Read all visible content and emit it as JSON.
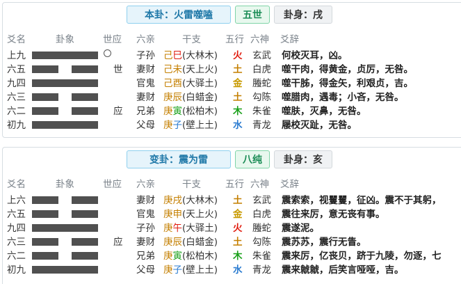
{
  "ben": {
    "title": "本卦：火雷噬嗑",
    "shi": "五世",
    "body": "卦身：戌",
    "headers": {
      "yao": "爻名",
      "gua": "卦象",
      "shiying": "世应",
      "liuqin": "六亲",
      "ganzhi": "干支",
      "wuxing": "五行",
      "liushen": "六神",
      "yaoci": "爻辞"
    },
    "rows": [
      {
        "name": "上九",
        "type": "yang",
        "moving": true,
        "mark": "",
        "qin": "子孙",
        "stem": "己",
        "branch": "巳",
        "nayin": "(大林木)",
        "wx": "火",
        "shen": "玄武",
        "ci": "何校灭耳，凶。"
      },
      {
        "name": "六五",
        "type": "yin",
        "moving": false,
        "mark": "世",
        "qin": "妻财",
        "stem": "己",
        "branch": "未",
        "nayin": "(天上火)",
        "wx": "土",
        "shen": "白虎",
        "ci": "噬干肉，得黄金，贞厉，无咎。"
      },
      {
        "name": "九四",
        "type": "yang",
        "moving": false,
        "mark": "",
        "qin": "官鬼",
        "stem": "己",
        "branch": "酉",
        "nayin": "(大驿土)",
        "wx": "金",
        "shen": "螣蛇",
        "ci": "噬干胏，得金矢，利艰贞，吉。"
      },
      {
        "name": "六三",
        "type": "yin",
        "moving": false,
        "mark": "",
        "qin": "妻财",
        "stem": "庚",
        "branch": "辰",
        "nayin": "(白蜡金)",
        "wx": "土",
        "shen": "勾陈",
        "ci": "噬腊肉，遇毒；小吝，无咎。"
      },
      {
        "name": "六二",
        "type": "yin",
        "moving": false,
        "mark": "应",
        "qin": "兄弟",
        "stem": "庚",
        "branch": "寅",
        "nayin": "(松柏木)",
        "wx": "木",
        "shen": "朱雀",
        "ci": "噬肤，灭鼻，无咎。"
      },
      {
        "name": "初九",
        "type": "yang",
        "moving": false,
        "mark": "",
        "qin": "父母",
        "stem": "庚",
        "branch": "子",
        "nayin": "(壁上土)",
        "wx": "水",
        "shen": "青龙",
        "ci": "屦校灭趾，无咎。"
      }
    ]
  },
  "bian": {
    "title": "变卦：震为雷",
    "shi": "八纯",
    "body": "卦身：亥",
    "headers": {
      "yao": "爻名",
      "gua": "卦象",
      "shiying": "世应",
      "liuqin": "六亲",
      "ganzhi": "干支",
      "wuxing": "五行",
      "liushen": "六神",
      "yaoci": "爻辞"
    },
    "rows": [
      {
        "name": "上六",
        "type": "yin",
        "moving": false,
        "mark": "",
        "qin": "妻财",
        "stem": "庚",
        "branch": "戌",
        "nayin": "(大林木)",
        "wx": "土",
        "shen": "玄武",
        "ci": "震索索，视矍矍，征凶。震不于其躬，"
      },
      {
        "name": "六五",
        "type": "yin",
        "moving": false,
        "mark": "",
        "qin": "官鬼",
        "stem": "庚",
        "branch": "申",
        "nayin": "(天上火)",
        "wx": "金",
        "shen": "白虎",
        "ci": "震往来厉，意无丧有事。"
      },
      {
        "name": "九四",
        "type": "yang",
        "moving": false,
        "mark": "",
        "qin": "子孙",
        "stem": "庚",
        "branch": "午",
        "nayin": "(大驿土)",
        "wx": "火",
        "shen": "螣蛇",
        "ci": "震遂泥。"
      },
      {
        "name": "六三",
        "type": "yin",
        "moving": false,
        "mark": "应",
        "qin": "妻财",
        "stem": "庚",
        "branch": "辰",
        "nayin": "(白蜡金)",
        "wx": "土",
        "shen": "勾陈",
        "ci": "震苏苏，震行无眚。"
      },
      {
        "name": "六二",
        "type": "yin",
        "moving": false,
        "mark": "",
        "qin": "兄弟",
        "stem": "庚",
        "branch": "寅",
        "nayin": "(松柏木)",
        "wx": "木",
        "shen": "朱雀",
        "ci": "震来厉，亿丧贝，跻于九陵，勿逐，七"
      },
      {
        "name": "初九",
        "type": "yang",
        "moving": false,
        "mark": "",
        "qin": "父母",
        "stem": "庚",
        "branch": "子",
        "nayin": "(壁上土)",
        "wx": "水",
        "shen": "青龙",
        "ci": "震来虩虩，后笑言哑哑，吉。"
      }
    ]
  }
}
